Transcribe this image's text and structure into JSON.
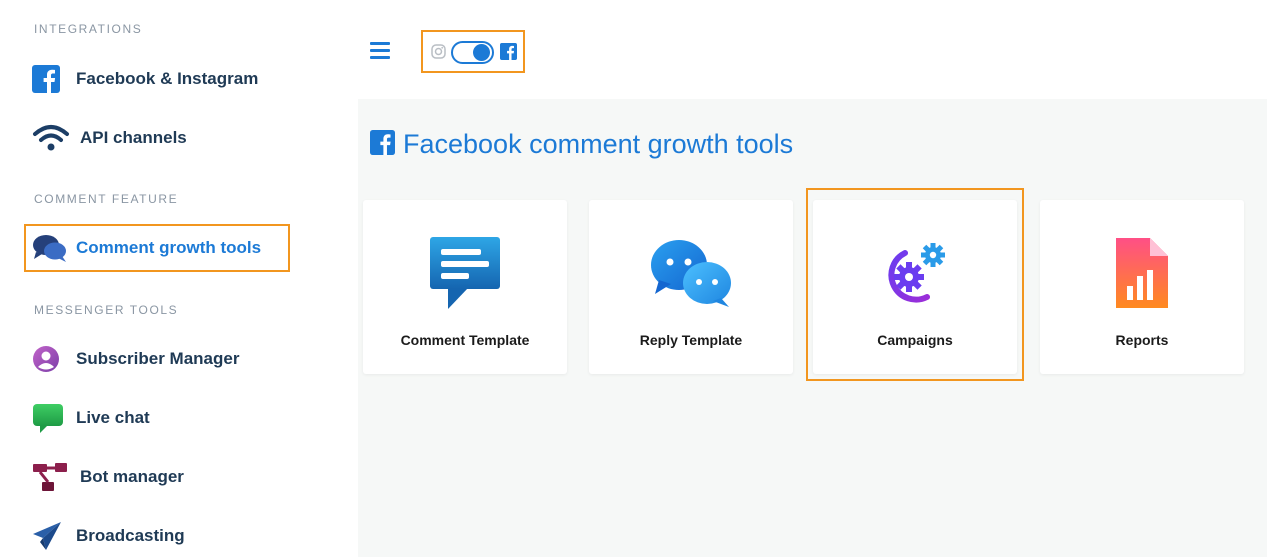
{
  "sidebar": {
    "sections": {
      "integrations": "INTEGRATIONS",
      "comment_feature": "COMMENT FEATURE",
      "messenger_tools": "MESSENGER TOOLS"
    },
    "items": [
      {
        "label": "Facebook & Instagram",
        "icon": "facebook-icon"
      },
      {
        "label": "API channels",
        "icon": "wifi-icon"
      },
      {
        "label": "Comment growth tools",
        "icon": "chat-bubbles-icon",
        "active": true
      },
      {
        "label": "Subscriber Manager",
        "icon": "user-circle-icon"
      },
      {
        "label": "Live chat",
        "icon": "chat-bubble-icon"
      },
      {
        "label": "Bot manager",
        "icon": "flow-icon"
      },
      {
        "label": "Broadcasting",
        "icon": "paper-plane-icon"
      }
    ]
  },
  "topbar": {
    "toggle_state": "facebook",
    "left_icon": "instagram-icon",
    "right_icon": "facebook-icon"
  },
  "main": {
    "title": "Facebook comment growth tools",
    "cards": [
      {
        "label": "Comment Template",
        "icon": "comment-template-icon"
      },
      {
        "label": "Reply Template",
        "icon": "reply-template-icon"
      },
      {
        "label": "Campaigns",
        "icon": "campaigns-gear-icon"
      },
      {
        "label": "Reports",
        "icon": "reports-icon"
      }
    ]
  },
  "colors": {
    "accent": "#1c7ad6",
    "highlight": "#f2961f",
    "text": "#1f3a55",
    "muted": "#8a96a3",
    "background": "#f6f8f7"
  }
}
